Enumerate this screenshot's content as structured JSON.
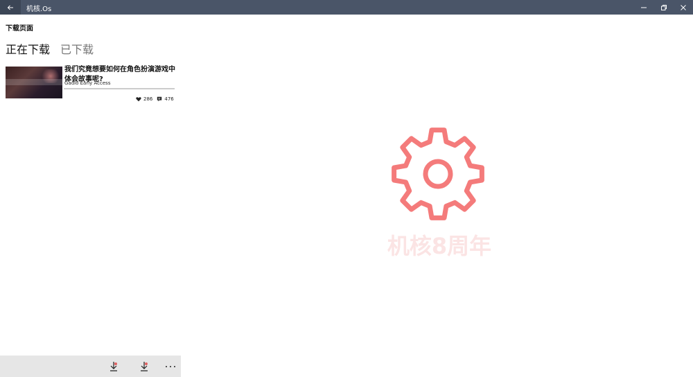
{
  "window": {
    "title": "机核.Os",
    "back_icon": "back-arrow-icon",
    "minimize_icon": "minimize-icon",
    "restore_icon": "restore-icon",
    "close_icon": "close-icon"
  },
  "page": {
    "heading": "下载页面",
    "tabs": [
      {
        "label": "正在下载",
        "active": true
      },
      {
        "label": "已下载",
        "active": false
      }
    ]
  },
  "downloads": [
    {
      "title": "我们究竟想要如何在角色扮演游戏中体会故事呢?",
      "source": "Gadio Early Access",
      "progress": 0.0,
      "likes": "286",
      "comments": "476"
    }
  ],
  "watermark": {
    "text": "机核8周年",
    "icon": "gear-icon",
    "color": "#f47b7b"
  },
  "appbar": {
    "buttons": [
      "download-icon",
      "download-icon",
      "more-icon"
    ]
  }
}
